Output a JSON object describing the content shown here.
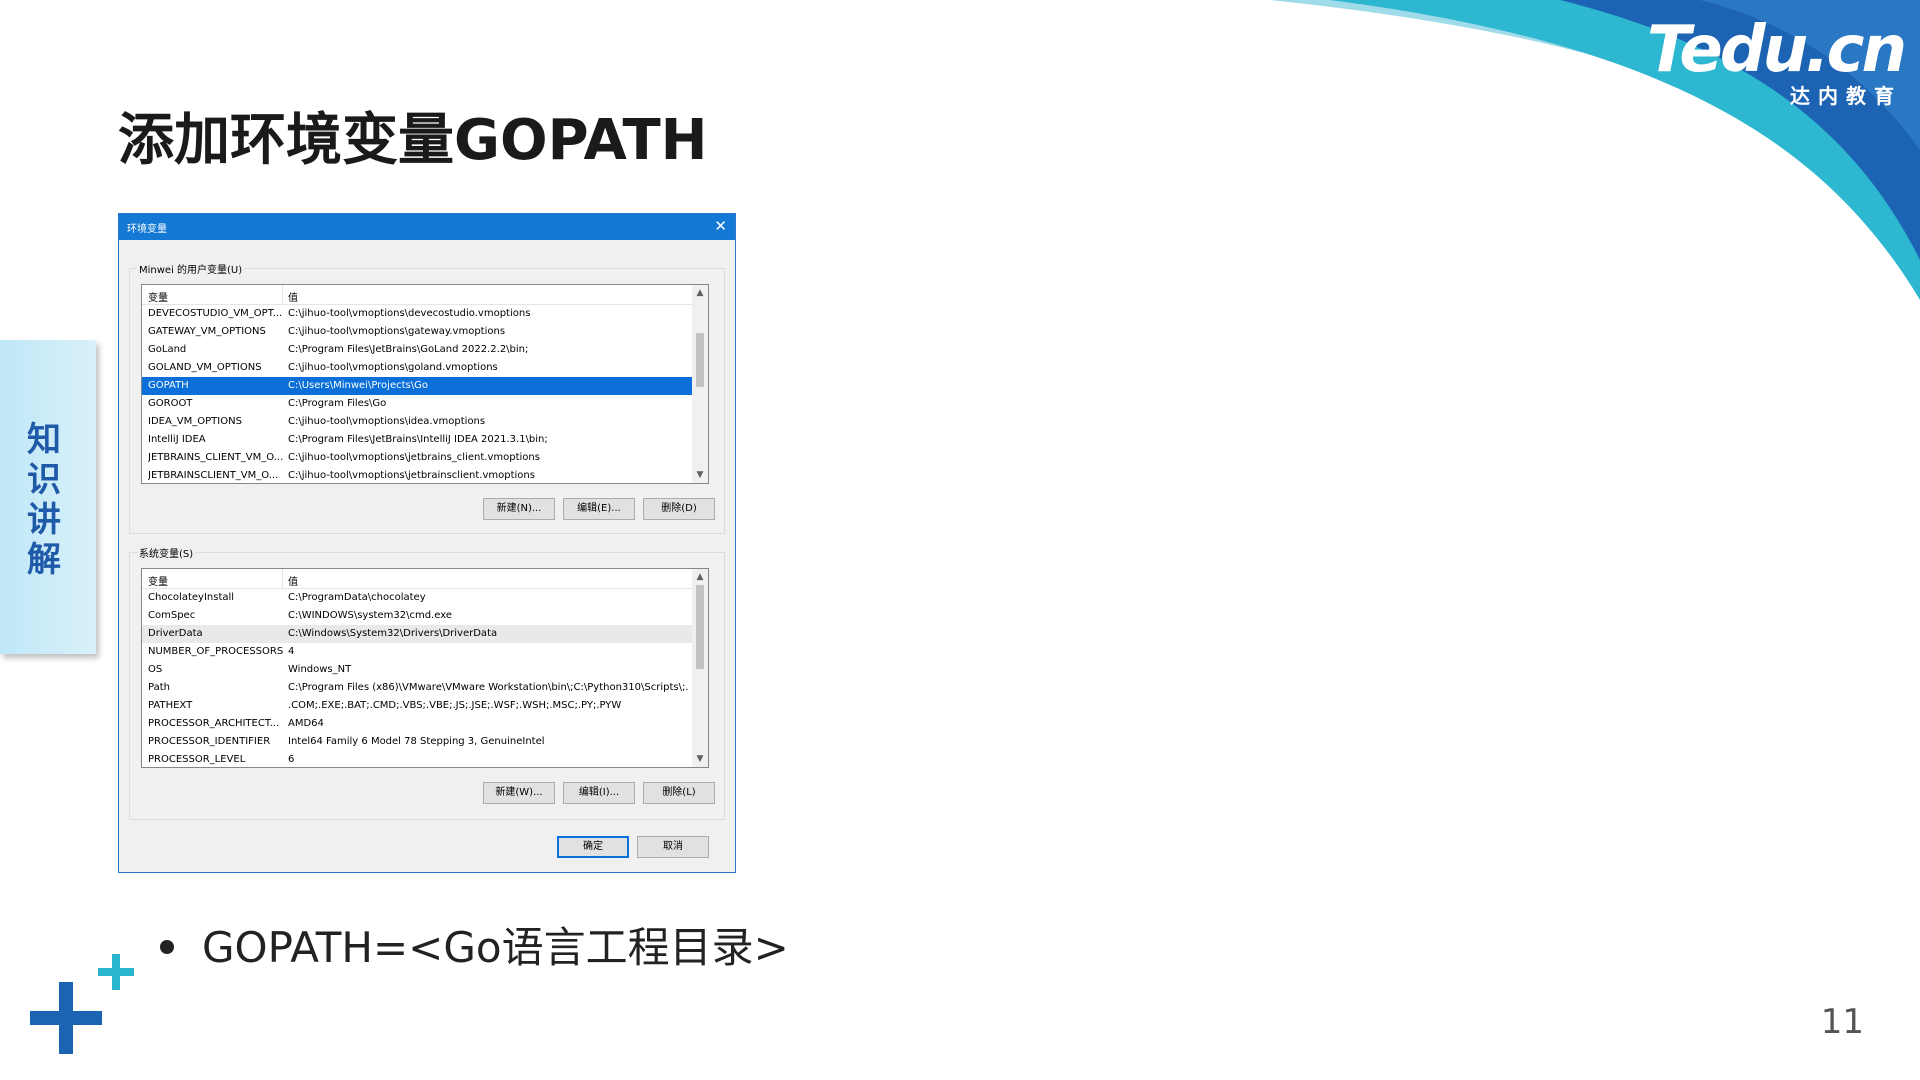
{
  "colors": {
    "swoosh_light": "#8fd6e4",
    "swoosh_mid": "#2ab5cf",
    "swoosh_dark": "#1d63b3",
    "accent_blue": "#1f5aa8",
    "dialog_titlebar": "#1479d4",
    "selected_row": "#0a6fd8"
  },
  "logo": {
    "main": "Tedu.cn",
    "sub": "达内教育"
  },
  "slide": {
    "title": "添加环境变量GOPATH",
    "side_tab": "知识讲解",
    "bullet": "GOPATH=<Go语言工程目录>",
    "page_number": "11"
  },
  "dialog": {
    "title": "环境变量",
    "close_glyph": "✕",
    "user_group_label": "Minwei 的用户变量(U)",
    "system_group_label": "系统变量(S)",
    "col_variable": "变量",
    "col_value": "值",
    "user_vars": [
      {
        "name": "DEVECOSTUDIO_VM_OPT...",
        "value": "C:\\jihuo-tool\\vmoptions\\devecostudio.vmoptions"
      },
      {
        "name": "GATEWAY_VM_OPTIONS",
        "value": "C:\\jihuo-tool\\vmoptions\\gateway.vmoptions"
      },
      {
        "name": "GoLand",
        "value": "C:\\Program Files\\JetBrains\\GoLand 2022.2.2\\bin;"
      },
      {
        "name": "GOLAND_VM_OPTIONS",
        "value": "C:\\jihuo-tool\\vmoptions\\goland.vmoptions"
      },
      {
        "name": "GOPATH",
        "value": "C:\\Users\\Minwei\\Projects\\Go"
      },
      {
        "name": "GOROOT",
        "value": "C:\\Program Files\\Go"
      },
      {
        "name": "IDEA_VM_OPTIONS",
        "value": "C:\\jihuo-tool\\vmoptions\\idea.vmoptions"
      },
      {
        "name": "IntelliJ IDEA",
        "value": "C:\\Program Files\\JetBrains\\IntelliJ IDEA 2021.3.1\\bin;"
      },
      {
        "name": "JETBRAINS_CLIENT_VM_O...",
        "value": "C:\\jihuo-tool\\vmoptions\\jetbrains_client.vmoptions"
      },
      {
        "name": "JETBRAINSCLIENT_VM_O...",
        "value": "C:\\jihuo-tool\\vmoptions\\jetbrainsclient.vmoptions"
      }
    ],
    "system_vars": [
      {
        "name": "ChocolateyInstall",
        "value": "C:\\ProgramData\\chocolatey"
      },
      {
        "name": "ComSpec",
        "value": "C:\\WINDOWS\\system32\\cmd.exe"
      },
      {
        "name": "DriverData",
        "value": "C:\\Windows\\System32\\Drivers\\DriverData"
      },
      {
        "name": "NUMBER_OF_PROCESSORS",
        "value": "4"
      },
      {
        "name": "OS",
        "value": "Windows_NT"
      },
      {
        "name": "Path",
        "value": "C:\\Program Files (x86)\\VMware\\VMware Workstation\\bin\\;C:\\Python310\\Scripts\\;..."
      },
      {
        "name": "PATHEXT",
        "value": ".COM;.EXE;.BAT;.CMD;.VBS;.VBE;.JS;.JSE;.WSF;.WSH;.MSC;.PY;.PYW"
      },
      {
        "name": "PROCESSOR_ARCHITECT...",
        "value": "AMD64"
      },
      {
        "name": "PROCESSOR_IDENTIFIER",
        "value": "Intel64 Family 6 Model 78 Stepping 3, GenuineIntel"
      },
      {
        "name": "PROCESSOR_LEVEL",
        "value": "6"
      }
    ],
    "user_buttons": {
      "new": "新建(N)...",
      "edit": "编辑(E)...",
      "delete": "删除(D)"
    },
    "system_buttons": {
      "new": "新建(W)...",
      "edit": "编辑(I)...",
      "delete": "删除(L)"
    },
    "ok": "确定",
    "cancel": "取消"
  }
}
